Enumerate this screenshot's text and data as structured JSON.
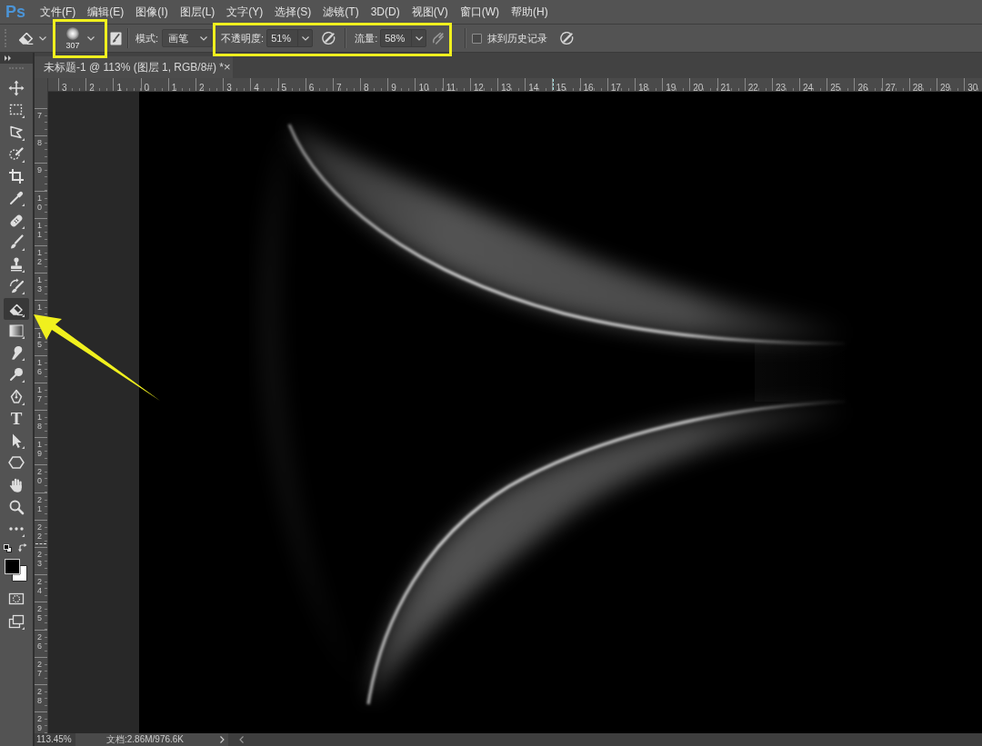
{
  "menu_bar": {
    "logo": "Ps",
    "items": [
      "文件(F)",
      "编辑(E)",
      "图像(I)",
      "图层(L)",
      "文字(Y)",
      "选择(S)",
      "滤镜(T)",
      "3D(D)",
      "视图(V)",
      "窗口(W)",
      "帮助(H)"
    ]
  },
  "options_bar": {
    "brush_preset": {
      "size": "307",
      "highlighted": true
    },
    "mode": {
      "label": "模式:",
      "value": "画笔"
    },
    "opacity_flow": {
      "highlighted": true,
      "opacity": {
        "label": "不透明度:",
        "value": "51%"
      },
      "flow": {
        "label": "流量:",
        "value": "58%"
      }
    },
    "history_checkbox": {
      "label": "抹到历史记录",
      "checked": false
    }
  },
  "document_tab": {
    "title": "未标题-1 @ 113% (图层 1, RGB/8#) *",
    "close": "×"
  },
  "toolbar": {
    "tools": [
      {
        "kind": "move",
        "selected": false,
        "annotated": false
      },
      {
        "kind": "marquee",
        "selected": false,
        "annotated": false
      },
      {
        "kind": "lasso",
        "selected": false,
        "annotated": false
      },
      {
        "kind": "quick-select",
        "selected": false,
        "annotated": false
      },
      {
        "kind": "crop",
        "selected": false,
        "annotated": false
      },
      {
        "kind": "eyedropper",
        "selected": false,
        "annotated": false
      },
      {
        "kind": "healing",
        "selected": false,
        "annotated": false
      },
      {
        "kind": "brush",
        "selected": false,
        "annotated": false
      },
      {
        "kind": "stamp",
        "selected": false,
        "annotated": false
      },
      {
        "kind": "history-brush",
        "selected": false,
        "annotated": false
      },
      {
        "kind": "eraser",
        "selected": true,
        "annotated": true
      },
      {
        "kind": "gradient",
        "selected": false,
        "annotated": false
      },
      {
        "kind": "smudge",
        "selected": false,
        "annotated": false
      },
      {
        "kind": "dodge",
        "selected": false,
        "annotated": false
      },
      {
        "kind": "pen",
        "selected": false,
        "annotated": false
      },
      {
        "kind": "type",
        "glyph": "T",
        "selected": false,
        "annotated": false
      },
      {
        "kind": "path-select",
        "selected": false,
        "annotated": false
      },
      {
        "kind": "shape",
        "selected": false,
        "annotated": false
      },
      {
        "kind": "hand",
        "selected": false,
        "annotated": false
      },
      {
        "kind": "zoom",
        "selected": false,
        "annotated": false
      },
      {
        "kind": "more",
        "selected": false,
        "annotated": false
      }
    ],
    "swatches": [
      {
        "kind": "foreground",
        "color": "#000000"
      },
      {
        "kind": "background",
        "color": "#ffffff"
      }
    ],
    "bottom_tools": [
      {
        "kind": "quick-mask"
      },
      {
        "kind": "screen-mode"
      }
    ]
  },
  "rulers": {
    "horizontal": [
      "3",
      "2",
      "1",
      "0",
      "1",
      "2",
      "3",
      "4",
      "5",
      "6",
      "7",
      "8",
      "9",
      "10",
      "11",
      "12",
      "13",
      "14",
      "15",
      "16",
      "17",
      "18",
      "19",
      "20",
      "21",
      "22",
      "23",
      "24",
      "25",
      "26",
      "27",
      "28",
      "29",
      "30"
    ],
    "vertical": [
      "7",
      "8",
      "9",
      "10",
      "11",
      "12",
      "13",
      "1",
      "15",
      "16",
      "17",
      "18",
      "19",
      "20",
      "21",
      "22",
      "23",
      "24",
      "25",
      "26",
      "27",
      "28",
      "29"
    ]
  },
  "status_bar": {
    "zoom": "113.45%",
    "document": "文档:2.86M/976.6K"
  }
}
